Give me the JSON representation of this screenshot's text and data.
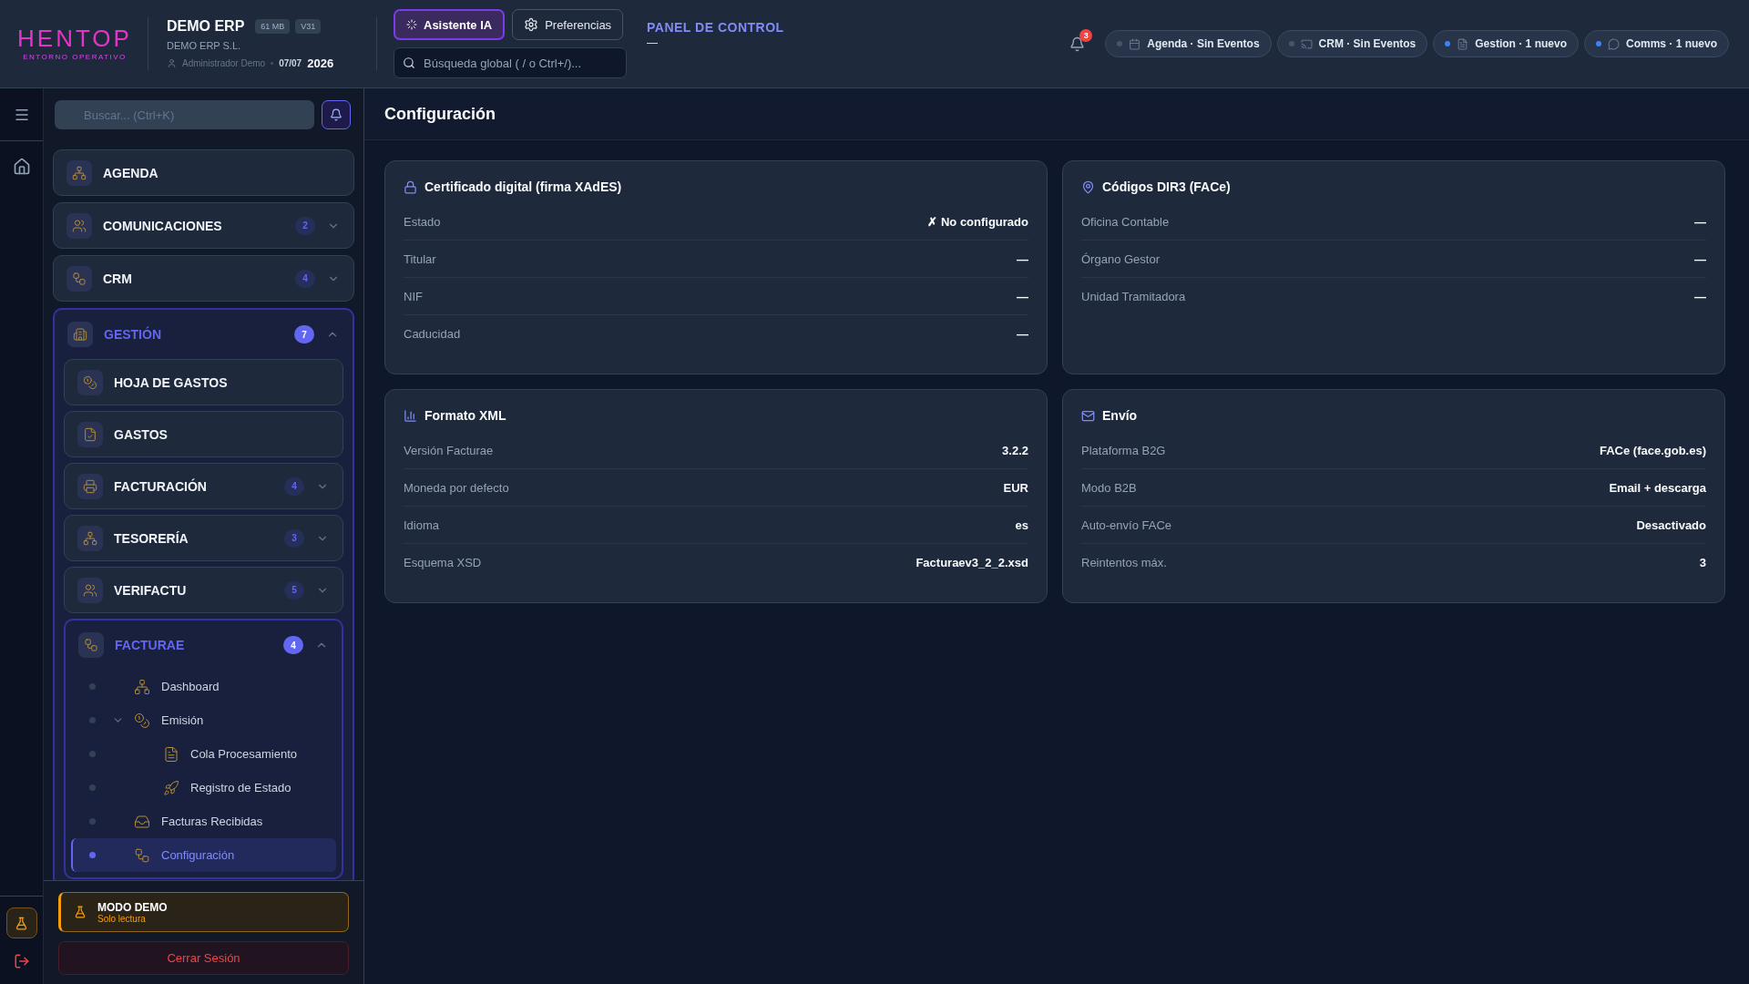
{
  "header": {
    "logo": {
      "name": "HENTOP",
      "tagline": "ENTORNO OPERATIVO"
    },
    "company": {
      "name": "DEMO ERP",
      "badges": [
        "61 MB",
        "V31"
      ],
      "legal_name": "DEMO ERP S.L.",
      "user": "Administrador Demo",
      "date": "07/07",
      "year": "2026"
    },
    "buttons": [
      {
        "label": "Asistente IA",
        "selected": true
      },
      {
        "label": "Preferencias",
        "selected": false
      }
    ],
    "search": {
      "placeholder": "Búsqueda global ( / o Ctrl+/)..."
    },
    "section": {
      "title": "PANEL DE CONTROL",
      "subtitle": "—"
    },
    "notifications": {
      "count": "3"
    },
    "chips": [
      {
        "label": "Agenda · Sin Eventos",
        "active": false
      },
      {
        "label": "CRM · Sin Eventos",
        "active": false
      },
      {
        "label": "Gestion · 1 nuevo",
        "active": true
      },
      {
        "label": "Comms · 1 nuevo",
        "active": true
      }
    ]
  },
  "sidebar": {
    "search": {
      "placeholder": "Buscar... (Ctrl+K)"
    },
    "items": [
      {
        "kind": "card",
        "label": "AGENDA"
      },
      {
        "kind": "card",
        "label": "COMUNICACIONES",
        "badge": "2",
        "expanded": false
      },
      {
        "kind": "card",
        "label": "CRM",
        "badge": "4",
        "expanded": false
      },
      {
        "kind": "card",
        "label": "GESTIÓN",
        "badge": "7",
        "expanded": true,
        "children": [
          {
            "kind": "card",
            "label": "HOJA DE GASTOS"
          },
          {
            "kind": "card",
            "label": "GASTOS"
          },
          {
            "kind": "card",
            "label": "FACTURACIÓN",
            "badge": "4",
            "expanded": false
          },
          {
            "kind": "card",
            "label": "TESORERÍA",
            "badge": "3",
            "expanded": false
          },
          {
            "kind": "card",
            "label": "VERIFACTU",
            "badge": "5",
            "expanded": false
          },
          {
            "kind": "card",
            "label": "FACTURAE",
            "badge": "4",
            "expanded": true,
            "children": [
              {
                "kind": "link",
                "label": "Dashboard",
                "selected": false
              },
              {
                "kind": "link",
                "label": "Emisión",
                "selected": false,
                "expanded": true,
                "children": [
                  {
                    "kind": "link",
                    "label": "Cola Procesamiento",
                    "selected": false
                  },
                  {
                    "kind": "link",
                    "label": "Registro de Estado",
                    "selected": false
                  }
                ]
              },
              {
                "kind": "link",
                "label": "Facturas Recibidas",
                "selected": false
              },
              {
                "kind": "link",
                "label": "Configuración",
                "selected": true
              }
            ]
          }
        ]
      }
    ],
    "demo": {
      "title": "MODO DEMO",
      "subtitle": "Solo lectura"
    },
    "logout": "Cerrar Sesión"
  },
  "page": {
    "title": "Configuración",
    "cards": [
      {
        "title": "Certificado digital (firma XAdES)",
        "rows": [
          {
            "label": "Estado",
            "value": "✗ No configurado"
          },
          {
            "label": "Titular",
            "value": "—"
          },
          {
            "label": "NIF",
            "value": "—"
          },
          {
            "label": "Caducidad",
            "value": "—"
          }
        ]
      },
      {
        "title": "Códigos DIR3 (FACe)",
        "rows": [
          {
            "label": "Oficina Contable",
            "value": "—"
          },
          {
            "label": "Órgano Gestor",
            "value": "—"
          },
          {
            "label": "Unidad Tramitadora",
            "value": "—"
          }
        ]
      },
      {
        "title": "Formato XML",
        "rows": [
          {
            "label": "Versión Facturae",
            "value": "3.2.2"
          },
          {
            "label": "Moneda por defecto",
            "value": "EUR"
          },
          {
            "label": "Idioma",
            "value": "es"
          },
          {
            "label": "Esquema XSD",
            "value": "Facturaev3_2_2.xsd"
          }
        ]
      },
      {
        "title": "Envío",
        "rows": [
          {
            "label": "Plataforma B2G",
            "value": "FACe (face.gob.es)"
          },
          {
            "label": "Modo B2B",
            "value": "Email + descarga"
          },
          {
            "label": "Auto-envío FACe",
            "value": "Desactivado"
          },
          {
            "label": "Reintentos máx.",
            "value": "3"
          }
        ]
      }
    ]
  }
}
